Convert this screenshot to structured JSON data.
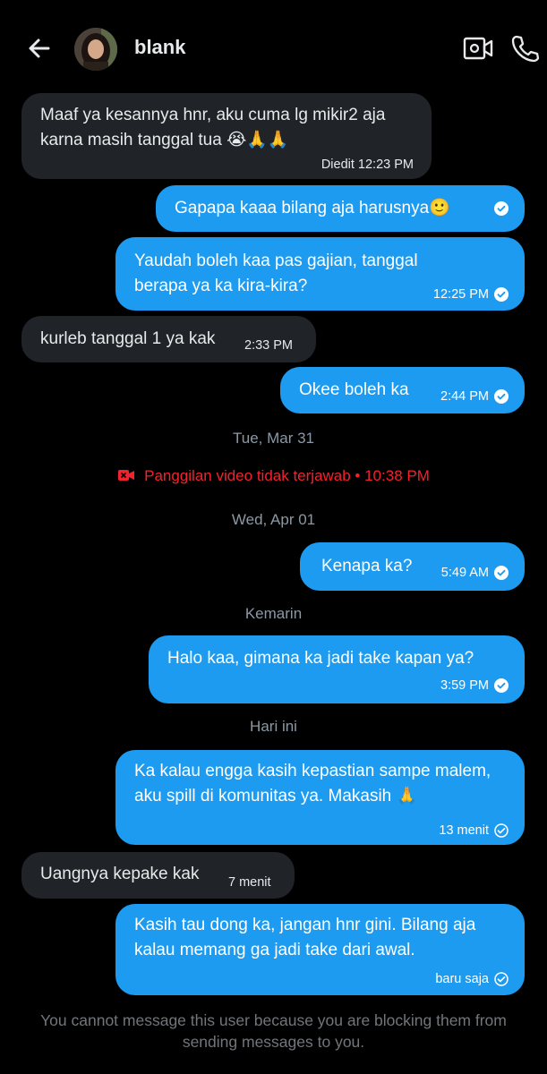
{
  "header": {
    "contact_name": "blank",
    "back_icon": "arrow-left-icon",
    "video_icon": "video-camera-icon",
    "phone_icon": "phone-icon"
  },
  "messages": [
    {
      "direction": "in",
      "text": "Maaf ya kesannya hnr, aku cuma lg mikir2 aja karna masih tanggal tua 😭🙏🙏",
      "time": "Diedit 12:23 PM"
    },
    {
      "direction": "out",
      "text": "Gapapa kaaa bilang aja harusnya🙂",
      "time": ""
    },
    {
      "direction": "out",
      "text": "Yaudah boleh kaa pas gajian, tanggal berapa ya ka kira-kira?",
      "time": "12:25 PM"
    },
    {
      "direction": "in",
      "text": "kurleb tanggal 1 ya kak",
      "time": "2:33 PM"
    },
    {
      "direction": "out",
      "text": "Okee boleh ka",
      "time": "2:44 PM"
    },
    {
      "direction": "out",
      "text": "Kenapa ka?",
      "time": "5:49 AM"
    },
    {
      "direction": "out",
      "text": "Halo kaa, gimana ka jadi take kapan ya?",
      "time": "3:59 PM"
    },
    {
      "direction": "out",
      "text": "Ka kalau engga kasih kepastian sampe malem, aku spill di komunitas ya. Makasih 🙏",
      "time": "13 menit"
    },
    {
      "direction": "in",
      "text": "Uangnya kepake kak",
      "time": "7 menit"
    },
    {
      "direction": "out",
      "text": "Kasih tau dong ka, jangan hnr gini. Bilang aja kalau memang ga jadi take dari awal.",
      "time": "baru saja"
    }
  ],
  "separators": [
    "Tue, Mar 31",
    "Wed, Apr 01",
    "Kemarin",
    "Hari ini"
  ],
  "missed_call": {
    "text": "Panggilan video tidak terjawab • 10:38 PM",
    "icon": "missed-video-icon",
    "color": "#f4212e"
  },
  "footer_notice": "You cannot message this user because you are blocking them from sending messages to you.",
  "colors": {
    "outgoing_bubble": "#1d9bf0",
    "incoming_bubble": "#202327",
    "background": "#000000",
    "muted_text": "#71767b"
  }
}
